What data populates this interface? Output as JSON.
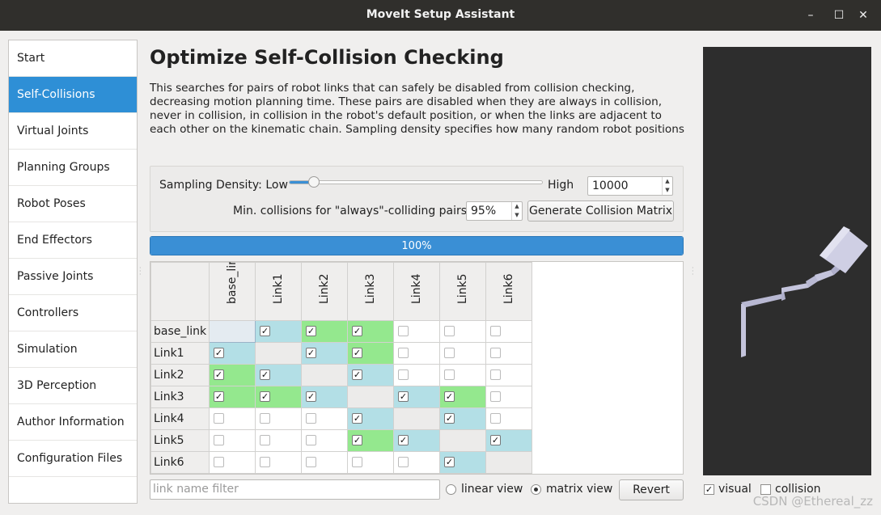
{
  "window": {
    "title": "MoveIt Setup Assistant",
    "minimize": "–",
    "maximize": "☐",
    "close": "✕"
  },
  "sidebar": {
    "items": [
      {
        "label": "Start"
      },
      {
        "label": "Self-Collisions"
      },
      {
        "label": "Virtual Joints"
      },
      {
        "label": "Planning Groups"
      },
      {
        "label": "Robot Poses"
      },
      {
        "label": "End Effectors"
      },
      {
        "label": "Passive Joints"
      },
      {
        "label": "Controllers"
      },
      {
        "label": "Simulation"
      },
      {
        "label": "3D Perception"
      },
      {
        "label": "Author Information"
      },
      {
        "label": "Configuration Files"
      }
    ],
    "active_index": 1
  },
  "page": {
    "title": "Optimize Self-Collision Checking",
    "description": "This searches for pairs of robot links that can safely be disabled from collision checking, decreasing motion planning time. These pairs are disabled when they are always in collision, never in collision, in collision in the robot's default position, or when the links are adjacent to each other on the kinematic chain. Sampling density specifies how many random robot positions"
  },
  "settings": {
    "density_label": "Sampling Density: Low",
    "density_high": "High",
    "density_value": "10000",
    "density_level": 0.1,
    "min_collisions_label": "Min. collisions for \"always\"-colliding pairs:",
    "min_collisions_value": "95%",
    "generate_button": "Generate Collision Matrix"
  },
  "progress": {
    "percent": 100,
    "text": "100%"
  },
  "matrix": {
    "links": [
      "base_link",
      "Link1",
      "Link2",
      "Link3",
      "Link4",
      "Link5",
      "Link6"
    ],
    "rows": [
      [
        {
          "s": "diag"
        },
        {
          "s": "blue",
          "c": true
        },
        {
          "s": "green",
          "c": true
        },
        {
          "s": "green",
          "c": true
        },
        {
          "s": "none",
          "c": false
        },
        {
          "s": "none",
          "c": false
        },
        {
          "s": "none",
          "c": false
        }
      ],
      [
        {
          "s": "blue",
          "c": true
        },
        {
          "s": "diag"
        },
        {
          "s": "blue",
          "c": true
        },
        {
          "s": "green",
          "c": true
        },
        {
          "s": "none",
          "c": false
        },
        {
          "s": "none",
          "c": false
        },
        {
          "s": "none",
          "c": false
        }
      ],
      [
        {
          "s": "green",
          "c": true
        },
        {
          "s": "blue",
          "c": true
        },
        {
          "s": "diag"
        },
        {
          "s": "blue",
          "c": true
        },
        {
          "s": "none",
          "c": false
        },
        {
          "s": "none",
          "c": false
        },
        {
          "s": "none",
          "c": false
        }
      ],
      [
        {
          "s": "green",
          "c": true
        },
        {
          "s": "green",
          "c": true
        },
        {
          "s": "blue",
          "c": true
        },
        {
          "s": "diag"
        },
        {
          "s": "blue",
          "c": true
        },
        {
          "s": "green",
          "c": true
        },
        {
          "s": "none",
          "c": false
        }
      ],
      [
        {
          "s": "none",
          "c": false
        },
        {
          "s": "none",
          "c": false
        },
        {
          "s": "none",
          "c": false
        },
        {
          "s": "blue",
          "c": true
        },
        {
          "s": "diag"
        },
        {
          "s": "blue",
          "c": true
        },
        {
          "s": "none",
          "c": false
        }
      ],
      [
        {
          "s": "none",
          "c": false
        },
        {
          "s": "none",
          "c": false
        },
        {
          "s": "none",
          "c": false
        },
        {
          "s": "green",
          "c": true
        },
        {
          "s": "blue",
          "c": true
        },
        {
          "s": "diag"
        },
        {
          "s": "blue",
          "c": true
        }
      ],
      [
        {
          "s": "none",
          "c": false
        },
        {
          "s": "none",
          "c": false
        },
        {
          "s": "none",
          "c": false
        },
        {
          "s": "none",
          "c": false
        },
        {
          "s": "none",
          "c": false
        },
        {
          "s": "blue",
          "c": true
        },
        {
          "s": "diag"
        }
      ]
    ],
    "checkmark": "✓"
  },
  "bottom": {
    "filter_placeholder": "link name filter",
    "linear_view": "linear view",
    "matrix_view": "matrix view",
    "selected_view": "matrix",
    "revert_button": "Revert"
  },
  "viewport": {
    "visual_label": "visual",
    "visual_checked": true,
    "collision_label": "collision",
    "collision_checked": false
  },
  "watermark": "CSDN @Ethereal_zz",
  "colors": {
    "accent": "#2e8fd6",
    "adjacent": "#b3dfe6",
    "default": "#94e88e",
    "viewport_bg": "#2d2d2d",
    "robot": "#c4c4dc"
  }
}
